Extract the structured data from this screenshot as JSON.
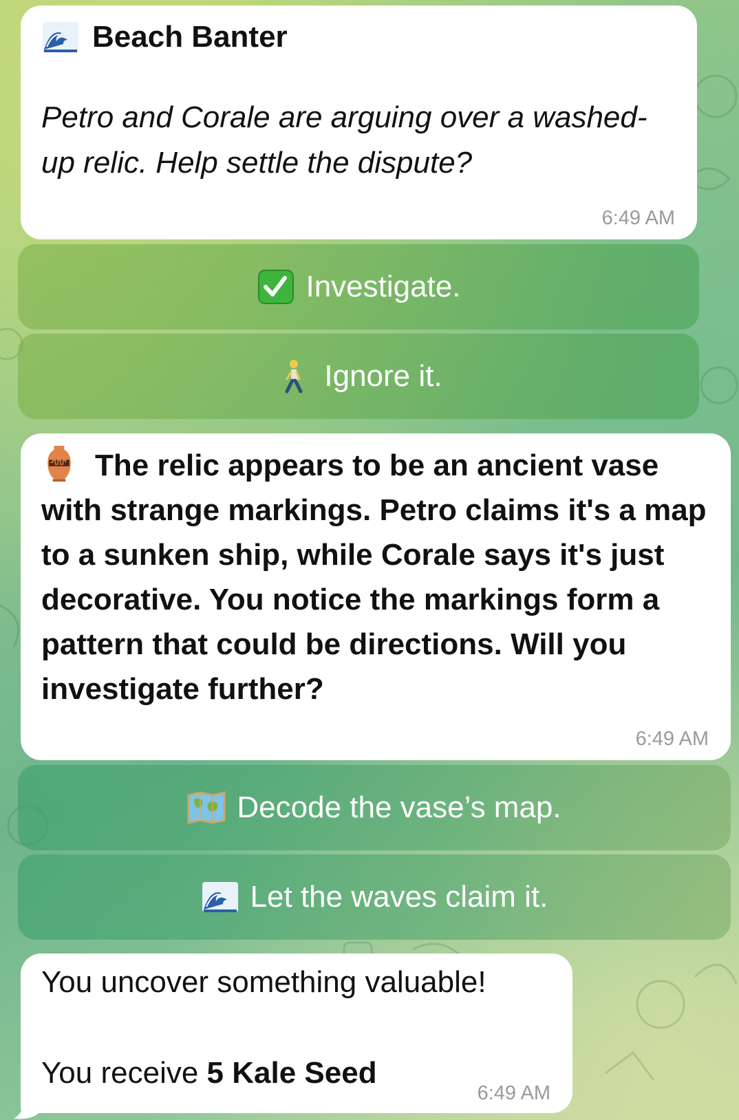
{
  "chat": {
    "msg1": {
      "icon": "wave-icon",
      "title": "Beach Banter",
      "body": "Petro and Corale are arguing over a washed-up relic. Help settle the dispute?",
      "time": "6:49 AM",
      "buttons": [
        {
          "icon": "check-mark-icon",
          "label": "Investigate."
        },
        {
          "icon": "walking-person-icon",
          "label": "Ignore it."
        }
      ]
    },
    "msg2": {
      "icon": "amphora-icon",
      "body": "The relic appears to be an ancient vase with strange markings. Petro claims it's a map to a sunken ship, while Corale says it's just decorative. You notice the markings form a pattern that could be directions. Will you investigate further?",
      "time": "6:49 AM",
      "buttons": [
        {
          "icon": "world-map-icon",
          "label": "Decode the vase’s map."
        },
        {
          "icon": "wave-icon",
          "label": "Let the waves claim it."
        }
      ]
    },
    "msg3": {
      "line1": "You uncover something valuable!",
      "line2_prefix": "You receive ",
      "line2_bold": "5 Kale Seed",
      "time": "6:49 AM"
    }
  }
}
